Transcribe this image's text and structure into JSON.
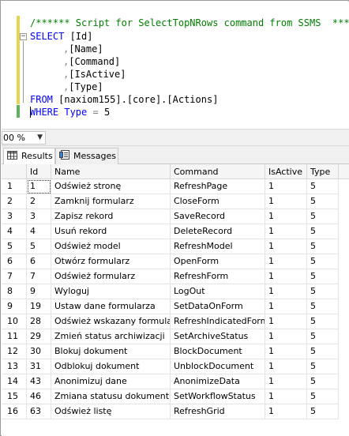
{
  "editor": {
    "comment": "/****** Script for SelectTopNRows command from SSMS  ******/",
    "line1_kw": "SELECT",
    "line1_rest": " [Id]",
    "col_name": "[Name]",
    "col_command": "[Command]",
    "col_isactive": "[IsActive]",
    "col_type": "[Type]",
    "from_kw": "FROM",
    "from_rest": " [naxiom155].[core].[Actions]",
    "where_kw": "WHERE",
    "where_col": " Type ",
    "where_op": "=",
    "where_val": " 5",
    "comma": ","
  },
  "zoom": {
    "value": "00 %"
  },
  "tabs": [
    {
      "label": "Results",
      "icon": "grid-icon"
    },
    {
      "label": "Messages",
      "icon": "messages-icon"
    }
  ],
  "grid": {
    "columns": [
      "Id",
      "Name",
      "Command",
      "IsActive",
      "Type"
    ],
    "rows": [
      {
        "n": "1",
        "id": "1",
        "name": "Odśwież stronę",
        "command": "RefreshPage",
        "isactive": "1",
        "type": "5"
      },
      {
        "n": "2",
        "id": "2",
        "name": "Zamknij formularz",
        "command": "CloseForm",
        "isactive": "1",
        "type": "5"
      },
      {
        "n": "3",
        "id": "3",
        "name": "Zapisz rekord",
        "command": "SaveRecord",
        "isactive": "1",
        "type": "5"
      },
      {
        "n": "4",
        "id": "4",
        "name": "Usuń rekord",
        "command": "DeleteRecord",
        "isactive": "1",
        "type": "5"
      },
      {
        "n": "5",
        "id": "5",
        "name": "Odśwież model",
        "command": "RefreshModel",
        "isactive": "1",
        "type": "5"
      },
      {
        "n": "6",
        "id": "6",
        "name": "Otwórz formularz",
        "command": "OpenForm",
        "isactive": "1",
        "type": "5"
      },
      {
        "n": "7",
        "id": "7",
        "name": "Odśwież formularz",
        "command": "RefreshForm",
        "isactive": "1",
        "type": "5"
      },
      {
        "n": "8",
        "id": "9",
        "name": "Wyloguj",
        "command": "LogOut",
        "isactive": "1",
        "type": "5"
      },
      {
        "n": "9",
        "id": "19",
        "name": "Ustaw dane formularza",
        "command": "SetDataOnForm",
        "isactive": "1",
        "type": "5"
      },
      {
        "n": "10",
        "id": "28",
        "name": "Odśwież wskazany formularz",
        "command": "RefreshIndicatedForm",
        "isactive": "1",
        "type": "5"
      },
      {
        "n": "11",
        "id": "29",
        "name": "Zmień status archiwizacji",
        "command": "SetArchiveStatus",
        "isactive": "1",
        "type": "5"
      },
      {
        "n": "12",
        "id": "30",
        "name": "Blokuj dokument",
        "command": "BlockDocument",
        "isactive": "1",
        "type": "5"
      },
      {
        "n": "13",
        "id": "31",
        "name": "Odblokuj dokument",
        "command": "UnblockDocument",
        "isactive": "1",
        "type": "5"
      },
      {
        "n": "14",
        "id": "43",
        "name": "Anonimizuj dane",
        "command": "AnonimizeData",
        "isactive": "1",
        "type": "5"
      },
      {
        "n": "15",
        "id": "46",
        "name": "Zmiana statusu dokumentu",
        "command": "SetWorkflowStatus",
        "isactive": "1",
        "type": "5"
      },
      {
        "n": "16",
        "id": "63",
        "name": "Odśwież listę",
        "command": "RefreshGrid",
        "isactive": "1",
        "type": "5"
      }
    ]
  }
}
